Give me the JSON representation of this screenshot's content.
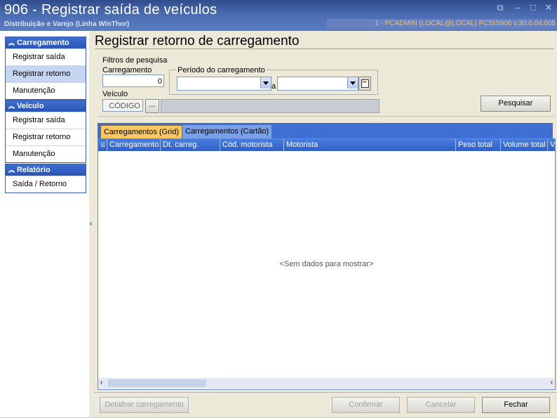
{
  "window": {
    "title": "906 - Registrar saída de veículos",
    "subtitle": "Distribuição e Varejo (Linha WinThor)",
    "user_info": "1 - PCADMIN (LOCAL@LOCAL)   PCSIS906  v.30.0.04.005",
    "buttons": {
      "restore": "⧉",
      "minimize": "–",
      "maximize": "□",
      "close": "✕"
    }
  },
  "sidebar": {
    "groups": [
      {
        "title": "Carregamento",
        "items": [
          "Registrar saída",
          "Registrar retorno",
          "Manutenção"
        ]
      },
      {
        "title": "Veículo",
        "items": [
          "Registrar saída",
          "Registrar retorno",
          "Manutenção"
        ]
      },
      {
        "title": "Relatório",
        "items": [
          "Saída / Retorno"
        ]
      }
    ],
    "active_item": "Registrar retorno",
    "collapse_arrow": "‹"
  },
  "main": {
    "heading": "Registrar retorno de carregamento",
    "filters": {
      "title": "Filtros de pesquisa",
      "carregamento_label": "Carregamento",
      "carregamento_value": "0",
      "periodo_label": "Período do carregamento",
      "date_from": "",
      "date_sep": "a",
      "date_to": "",
      "veiculo_label": "Veículo",
      "veiculo_code_placeholder": "CÓDIGO",
      "veiculo_lookup_btn": "...",
      "veiculo_desc": "",
      "search_button": "Pesquisar"
    },
    "tabs": [
      "Carregamentos (Grid)",
      "Carregamentos (Cartão)"
    ],
    "grid": {
      "columns": [
        "Carregamento",
        "Dt. carreg.",
        "Cód. motorista",
        "Motorista",
        "Peso total",
        "Volume total",
        "V"
      ],
      "empty_text": "<Sem dados para mostrar>"
    },
    "footer": {
      "detail_button": "Detalhar carregamento",
      "confirm_button": "Confirmar",
      "cancel_button": "Cancelar",
      "close_button": "Fechar"
    }
  }
}
